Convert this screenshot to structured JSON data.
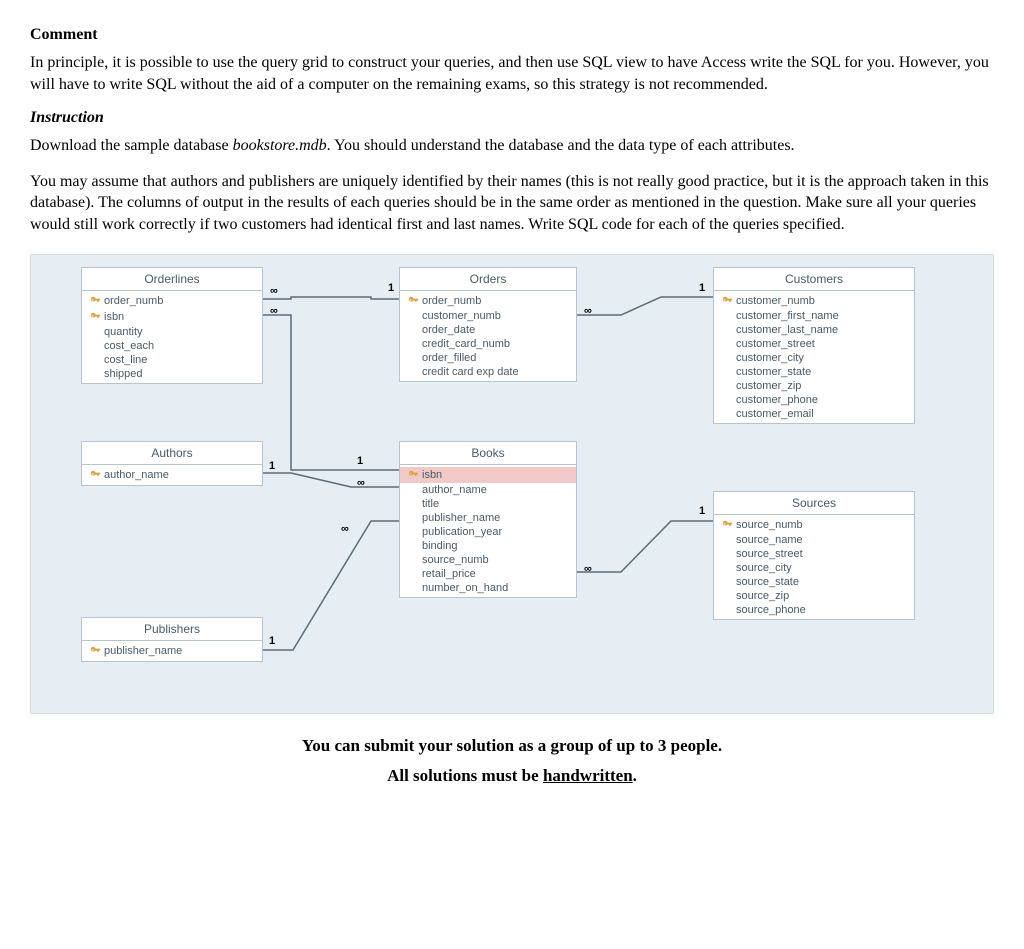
{
  "headings": {
    "comment": "Comment",
    "instruction": "Instruction"
  },
  "paragraphs": {
    "comment_body": "In principle, it is possible to use the query grid to construct your queries, and then use SQL view to have Access write the SQL for you.  However, you will have to write SQL without the aid of a computer on the remaining exams, so this strategy is not recommended.",
    "instr1a": "Download the sample database ",
    "instr1_file": "bookstore.mdb",
    "instr1b": ". You should understand the database and the data type of each attributes.",
    "instr2": "You may assume that authors and publishers are uniquely identified by their names (this is not really good practice, but it is the approach taken in this database).  The columns of output in the results of each queries should be in the same order as mentioned in the question.  Make sure all your queries would still work correctly if two customers had identical first and last names. Write SQL code for each of the queries specified."
  },
  "footer": {
    "line1": "You can submit your solution as a group of up to 3 people.",
    "line2a": "All solutions must be ",
    "line2b": "handwritten",
    "line2c": "."
  },
  "diagram": {
    "tables": {
      "orderlines": {
        "title": "Orderlines",
        "fields": [
          {
            "name": "order_numb",
            "pk": true
          },
          {
            "name": "isbn",
            "pk": true
          },
          {
            "name": "quantity",
            "pk": false
          },
          {
            "name": "cost_each",
            "pk": false
          },
          {
            "name": "cost_line",
            "pk": false
          },
          {
            "name": "shipped",
            "pk": false
          }
        ]
      },
      "orders": {
        "title": "Orders",
        "fields": [
          {
            "name": "order_numb",
            "pk": true
          },
          {
            "name": "customer_numb",
            "pk": false
          },
          {
            "name": "order_date",
            "pk": false
          },
          {
            "name": "credit_card_numb",
            "pk": false
          },
          {
            "name": "order_filled",
            "pk": false
          },
          {
            "name": "credit card exp date",
            "pk": false
          }
        ]
      },
      "customers": {
        "title": "Customers",
        "fields": [
          {
            "name": "customer_numb",
            "pk": true
          },
          {
            "name": "customer_first_name",
            "pk": false
          },
          {
            "name": "customer_last_name",
            "pk": false
          },
          {
            "name": "customer_street",
            "pk": false
          },
          {
            "name": "customer_city",
            "pk": false
          },
          {
            "name": "customer_state",
            "pk": false
          },
          {
            "name": "customer_zip",
            "pk": false
          },
          {
            "name": "customer_phone",
            "pk": false
          },
          {
            "name": "customer_email",
            "pk": false
          }
        ]
      },
      "authors": {
        "title": "Authors",
        "fields": [
          {
            "name": "author_name",
            "pk": true
          }
        ]
      },
      "books": {
        "title": "Books",
        "fields": [
          {
            "name": "isbn",
            "pk": true,
            "highlight": true
          },
          {
            "name": "author_name",
            "pk": false
          },
          {
            "name": "title",
            "pk": false
          },
          {
            "name": "publisher_name",
            "pk": false
          },
          {
            "name": "publication_year",
            "pk": false
          },
          {
            "name": "binding",
            "pk": false
          },
          {
            "name": "source_numb",
            "pk": false
          },
          {
            "name": "retail_price",
            "pk": false
          },
          {
            "name": "number_on_hand",
            "pk": false
          }
        ]
      },
      "publishers": {
        "title": "Publishers",
        "fields": [
          {
            "name": "publisher_name",
            "pk": true
          }
        ]
      },
      "sources": {
        "title": "Sources",
        "fields": [
          {
            "name": "source_numb",
            "pk": true
          },
          {
            "name": "source_name",
            "pk": false
          },
          {
            "name": "source_street",
            "pk": false
          },
          {
            "name": "source_city",
            "pk": false
          },
          {
            "name": "source_state",
            "pk": false
          },
          {
            "name": "source_zip",
            "pk": false
          },
          {
            "name": "source_phone",
            "pk": false
          }
        ]
      }
    },
    "cardinality": {
      "one": "1",
      "many": "∞"
    }
  }
}
